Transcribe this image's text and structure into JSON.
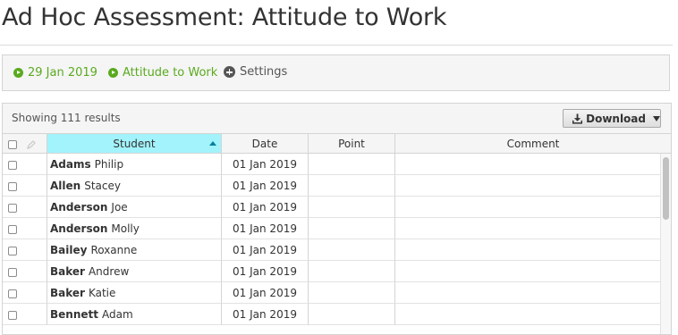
{
  "page": {
    "title": "Ad Hoc Assessment: Attitude to Work"
  },
  "crumbs": {
    "date": "29 Jan 2019",
    "assessment": "Attitude to Work",
    "settings": "Settings"
  },
  "toolbar": {
    "results": "Showing 111 results",
    "download": "Download"
  },
  "table": {
    "headers": {
      "student": "Student",
      "date": "Date",
      "point": "Point",
      "comment": "Comment"
    },
    "rows": [
      {
        "last": "Adams",
        "first": "Philip",
        "date": "01 Jan 2019",
        "point": "",
        "comment": ""
      },
      {
        "last": "Allen",
        "first": "Stacey",
        "date": "01 Jan 2019",
        "point": "",
        "comment": ""
      },
      {
        "last": "Anderson",
        "first": "Joe",
        "date": "01 Jan 2019",
        "point": "",
        "comment": ""
      },
      {
        "last": "Anderson",
        "first": "Molly",
        "date": "01 Jan 2019",
        "point": "",
        "comment": ""
      },
      {
        "last": "Bailey",
        "first": "Roxanne",
        "date": "01 Jan 2019",
        "point": "",
        "comment": ""
      },
      {
        "last": "Baker",
        "first": "Andrew",
        "date": "01 Jan 2019",
        "point": "",
        "comment": ""
      },
      {
        "last": "Baker",
        "first": "Katie",
        "date": "01 Jan 2019",
        "point": "",
        "comment": ""
      },
      {
        "last": "Bennett",
        "first": "Adam",
        "date": "01 Jan 2019",
        "point": "",
        "comment": ""
      }
    ]
  },
  "colors": {
    "accent_green": "#5aaa1f",
    "sorted_header": "#a2f3fb"
  }
}
